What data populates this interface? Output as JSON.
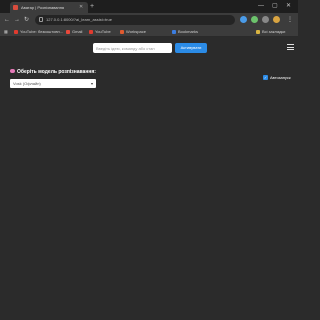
{
  "browser": {
    "tab_title": "Аватар | Розпізнавання",
    "tab_close": "✕",
    "new_tab": "+",
    "window_controls": {
      "minimize": "—",
      "maximize": "▢",
      "close": "✕"
    },
    "nav": {
      "back": "←",
      "forward": "→",
      "reload": "↻"
    },
    "url": "127.0.0.1:8000/?ai_learn_assist=true",
    "bookmarks": [
      {
        "label": "YouTube: безкоштовн...",
        "color": "#e03b2f"
      },
      {
        "label": "Gmail",
        "color": "#e9483b"
      },
      {
        "label": "YouTube",
        "color": "#e03b2f"
      },
      {
        "label": "Workspace",
        "color": "#e05a2f"
      },
      {
        "label": "Bookmarks",
        "color": "#3b7de0"
      }
    ],
    "all_bookmarks": "Всі закладки"
  },
  "page": {
    "search_placeholder": "Введіть ідею, команду або стан",
    "activate_label": "Активувати",
    "model_heading": "Оберіть модель розпізнавання:",
    "model_selected": "Vosk (Офлайн)",
    "auto_activate_label": "Автозапуск",
    "auto_checked": true
  }
}
